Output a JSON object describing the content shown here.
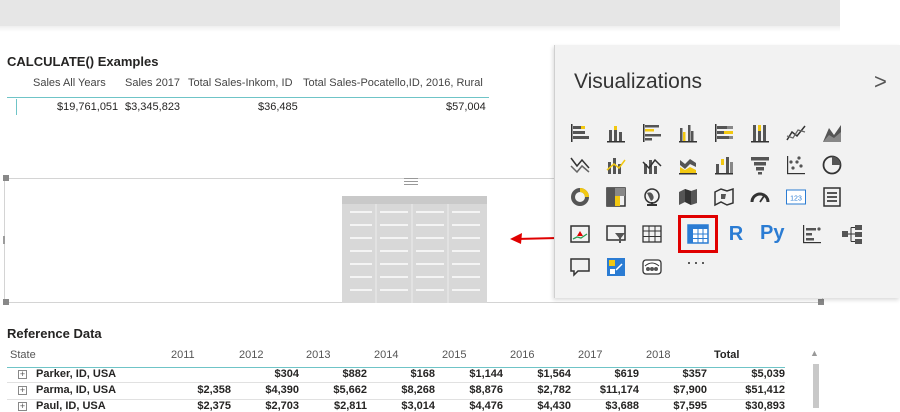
{
  "calc": {
    "title": "CALCULATE() Examples",
    "columns": [
      "Sales All Years",
      "Sales 2017",
      "Total Sales-Inkom, ID",
      "Total Sales-Pocatello,ID, 2016, Rural"
    ],
    "values": [
      "$19,761,051",
      "$3,345,823",
      "$36,485",
      "$57,004"
    ]
  },
  "viz": {
    "title": "Visualizations",
    "chevron": ">",
    "more": "···",
    "r_label": "R",
    "py_label": "Py",
    "card_label": "123",
    "colors": {
      "primary": "#2b7cd3",
      "yellow": "#f2c811",
      "red": "#e00000"
    }
  },
  "ref": {
    "title": "Reference Data",
    "headers": [
      "State",
      "2011",
      "2012",
      "2013",
      "2014",
      "2015",
      "2016",
      "2017",
      "2018",
      "Total"
    ],
    "rows": [
      {
        "state": "Parker, ID, USA",
        "values": [
          "",
          "$304",
          "$882",
          "$168",
          "$1,144",
          "$1,564",
          "$619",
          "$357",
          "$5,039"
        ]
      },
      {
        "state": "Parma, ID, USA",
        "values": [
          "$2,358",
          "$4,390",
          "$5,662",
          "$8,268",
          "$8,876",
          "$2,782",
          "$11,174",
          "$7,900",
          "$51,412"
        ]
      },
      {
        "state": "Paul, ID, USA",
        "values": [
          "$2,375",
          "$2,703",
          "$2,811",
          "$3,014",
          "$4,476",
          "$4,430",
          "$3,688",
          "$7,595",
          "$30,893"
        ]
      }
    ]
  }
}
